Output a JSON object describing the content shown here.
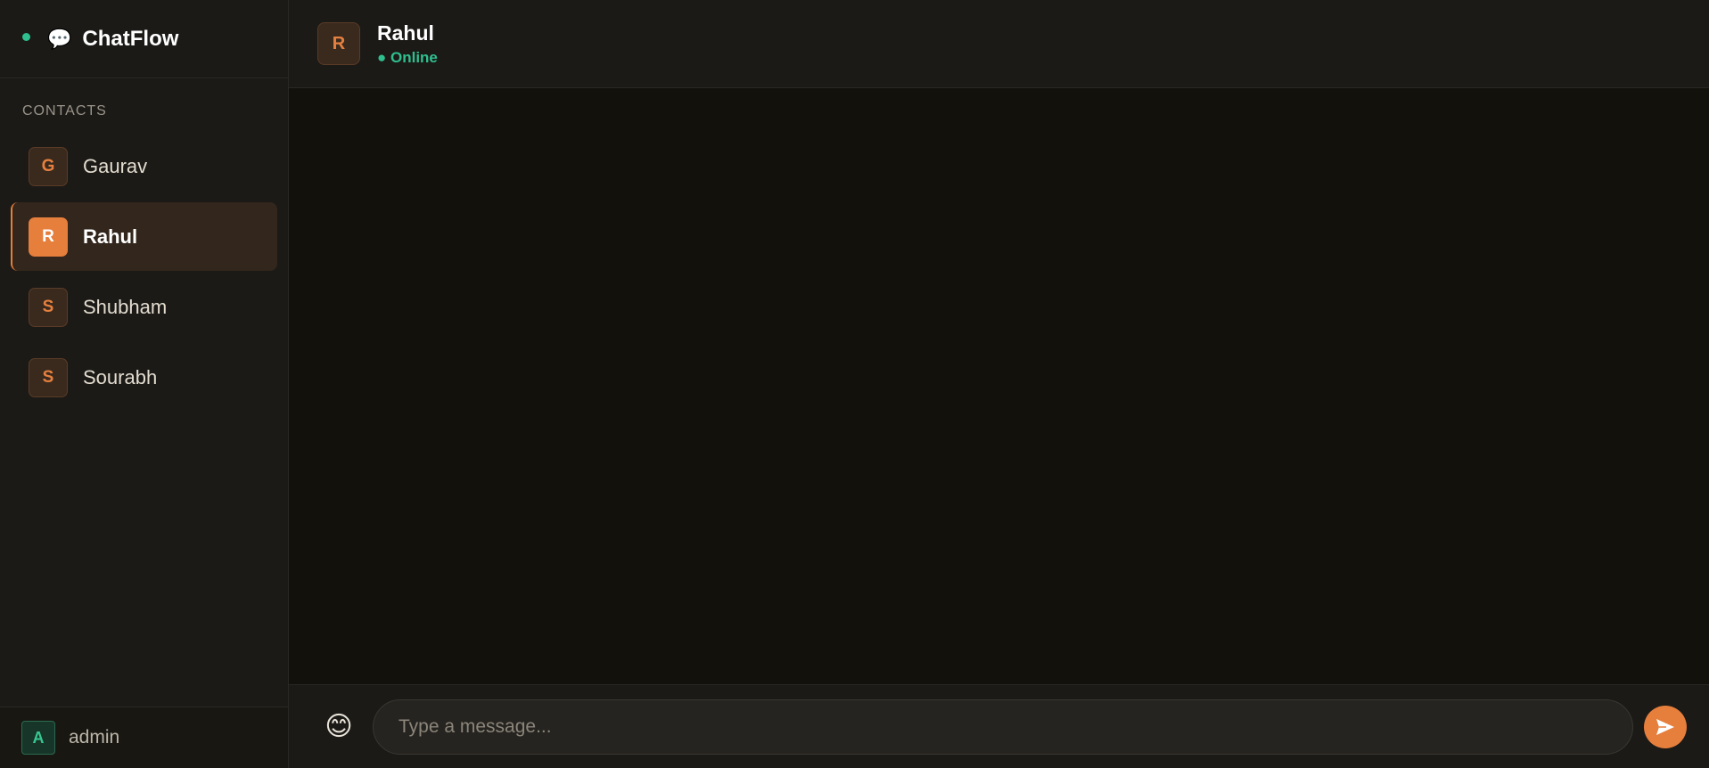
{
  "brand": {
    "icon": "speech-bubble-icon",
    "name": "ChatFlow"
  },
  "sidebar": {
    "section_label": "CONTACTS",
    "contacts": [
      {
        "initial": "G",
        "name": "Gaurav",
        "active": false
      },
      {
        "initial": "R",
        "name": "Rahul",
        "active": true
      },
      {
        "initial": "S",
        "name": "Shubham",
        "active": false
      },
      {
        "initial": "S",
        "name": "Sourabh",
        "active": false
      }
    ],
    "user": {
      "initial": "A",
      "name": "admin"
    }
  },
  "chat_header": {
    "initial": "R",
    "name": "Rahul",
    "status": "● Online"
  },
  "composer": {
    "emoji": "😊",
    "placeholder": "Type a message...",
    "value": "",
    "send_icon": "send-arrow-icon"
  },
  "colors": {
    "accent": "#e67e3c",
    "online": "#2fbf8f",
    "sidebar_bg": "#1b1a17",
    "chat_bg": "#12110c"
  }
}
